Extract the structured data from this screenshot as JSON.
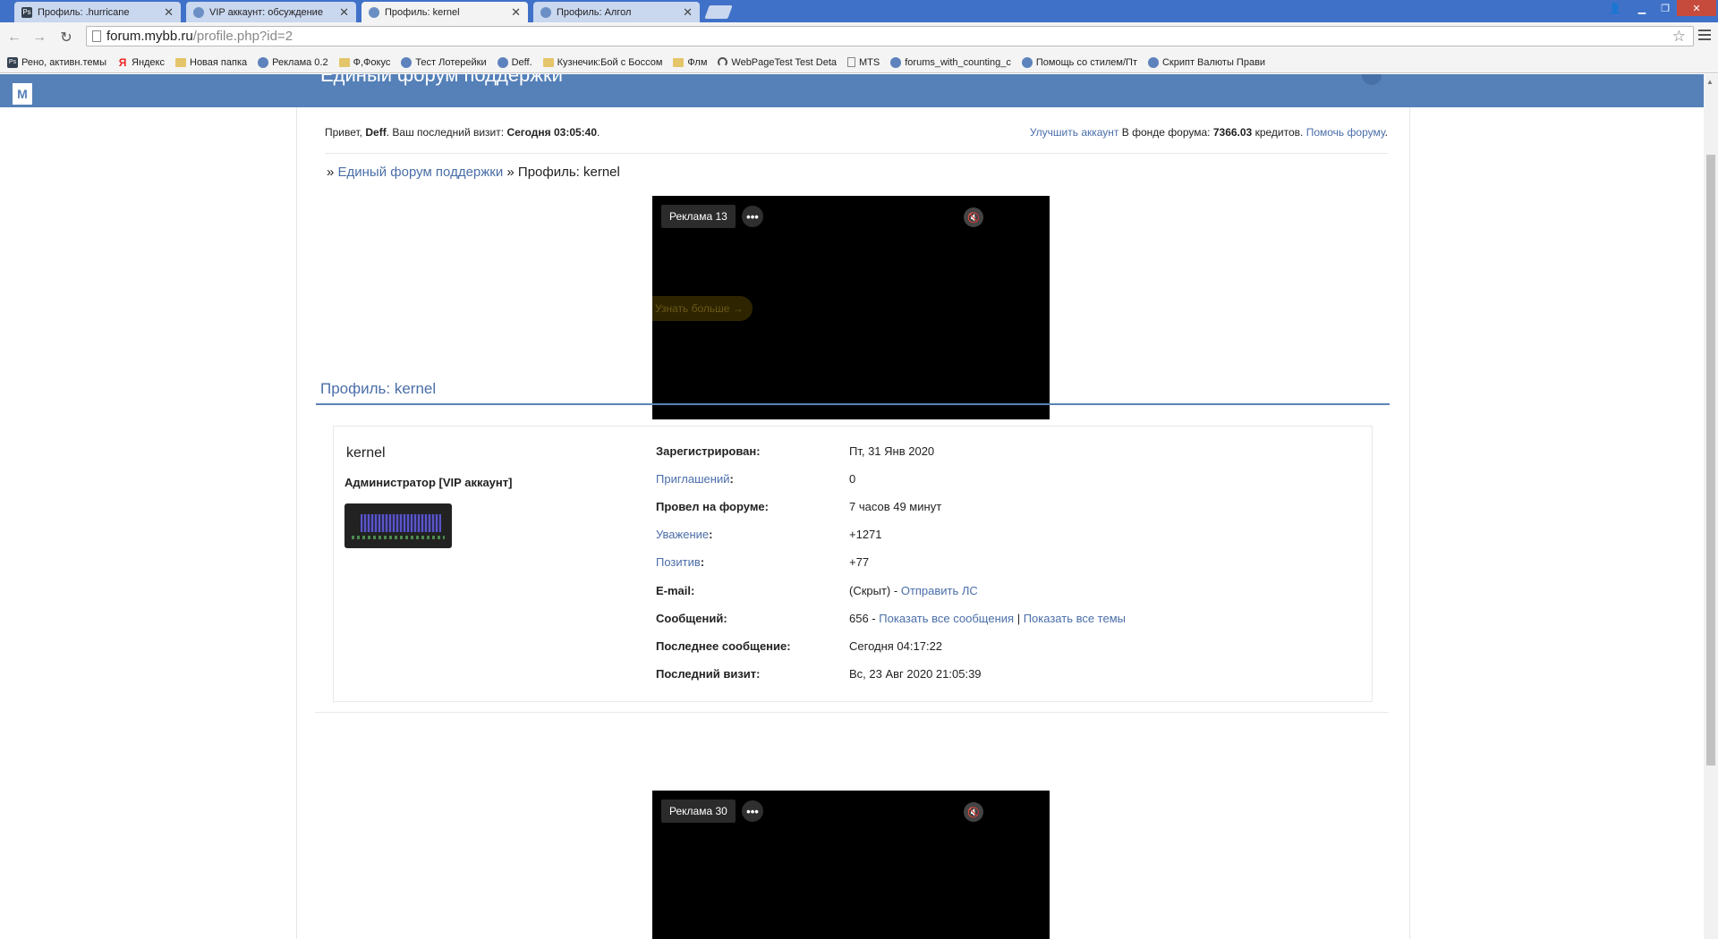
{
  "tabs": [
    {
      "title": "Профиль: .hurricane",
      "icon": "photoshop-icon"
    },
    {
      "title": "VIP аккаунт: обсуждение",
      "icon": "mybb-icon"
    },
    {
      "title": "Профиль: kernel",
      "icon": "mybb-icon"
    },
    {
      "title": "Профиль: Алгол",
      "icon": "mybb-icon"
    }
  ],
  "address": {
    "host": "forum.mybb.ru",
    "path": "/profile.php?id=2"
  },
  "bookmarks": [
    {
      "label": "Рено, активн.темы",
      "icon": "ps"
    },
    {
      "label": "Яндекс",
      "icon": "ya"
    },
    {
      "label": "Новая папка",
      "icon": "folder"
    },
    {
      "label": "Реклама 0.2",
      "icon": "mybb"
    },
    {
      "label": "Ф,Фокус",
      "icon": "folder"
    },
    {
      "label": "Тест Лотерейки",
      "icon": "mybb"
    },
    {
      "label": "Deff.",
      "icon": "mybb"
    },
    {
      "label": "Кузнечик:Бой с Боссом",
      "icon": "folder"
    },
    {
      "label": "Флм",
      "icon": "folder"
    },
    {
      "label": "WebPageTest Test Deta",
      "icon": "gauge"
    },
    {
      "label": "MTS",
      "icon": "doc"
    },
    {
      "label": "forums_with_counting_c",
      "icon": "mybb"
    },
    {
      "label": "Помощь со стилем/Пт",
      "icon": "mybb"
    },
    {
      "label": "Скрипт Валюты Прави",
      "icon": "mybb"
    }
  ],
  "site": {
    "title": "Единый форум поддержки",
    "logo": "M"
  },
  "welcome": {
    "greeting": "Привет,",
    "username": "Deff",
    "last_visit_label": ". Ваш последний визит:",
    "last_visit": "Сегодня 03:05:40",
    "upgrade_link": "Улучшить аккаунт",
    "fund_label": "В фонде форума:",
    "fund_amount": "7366.03",
    "fund_unit": "кредитов.",
    "help_link": "Помочь форуму",
    "period": "."
  },
  "breadcrumb": {
    "sep1": "»",
    "forum": "Единый форум поддержки",
    "sep2": "» Профиль: kernel"
  },
  "ad1": {
    "label": "Реклама 13",
    "more": "•••",
    "cta": "Узнать больше →"
  },
  "ad2": {
    "label": "Реклама 30",
    "more": "•••"
  },
  "profile": {
    "section_title": "Профиль: kernel",
    "username": "kernel",
    "user_title": "Администратор [VIP аккаунт]",
    "fields": {
      "registered": {
        "label": "Зарегистрирован:",
        "value": "Пт, 31 Янв 2020"
      },
      "invites": {
        "label": "Приглашений",
        "colon": ":",
        "value": "0"
      },
      "time_online": {
        "label": "Провел на форуме:",
        "value": "7 часов 49 минут"
      },
      "respect": {
        "label": "Уважение",
        "colon": ":",
        "value": "+1271"
      },
      "positive": {
        "label": "Позитив",
        "colon": ":",
        "value": "+77"
      },
      "email": {
        "label": "E-mail:",
        "value": "(Скрыт) -",
        "link": "Отправить ЛС"
      },
      "posts": {
        "label": "Сообщений:",
        "value": "656 -",
        "link1": "Показать все сообщения",
        "sep": "|",
        "link2": "Показать все темы"
      },
      "last_post": {
        "label": "Последнее сообщение:",
        "value": "Сегодня 04:17:22"
      },
      "last_visit": {
        "label": "Последний визит:",
        "value": "Вс, 23 Авг 2020 21:05:39"
      }
    }
  }
}
